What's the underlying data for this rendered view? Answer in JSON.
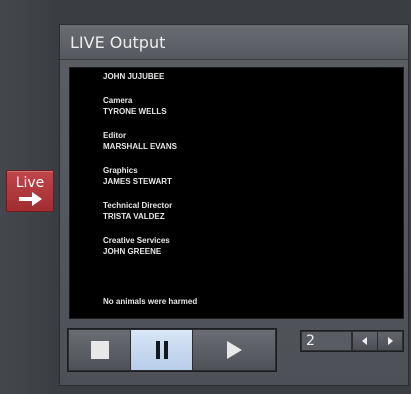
{
  "live_button": {
    "label": "Live",
    "color": "#b03a3e"
  },
  "panel": {
    "title": "LIVE Output",
    "credits": [
      {
        "role": "",
        "name": "JOHN JUJUBEE"
      },
      {
        "role": "Camera",
        "name": "TYRONE WELLS"
      },
      {
        "role": "Editor",
        "name": "MARSHALL EVANS"
      },
      {
        "role": "Graphics",
        "name": "JAMES STEWART"
      },
      {
        "role": "Technical Director",
        "name": "TRISTA VALDEZ"
      },
      {
        "role": "Creative Services",
        "name": "JOHN GREENE"
      }
    ],
    "footer_note": "No animals were harmed"
  },
  "transport": {
    "stop_icon": "stop-icon",
    "pause_icon": "pause-icon",
    "play_icon": "play-icon",
    "active": "pause",
    "active_color": "#c9d9ef"
  },
  "spinner": {
    "value": "2"
  }
}
